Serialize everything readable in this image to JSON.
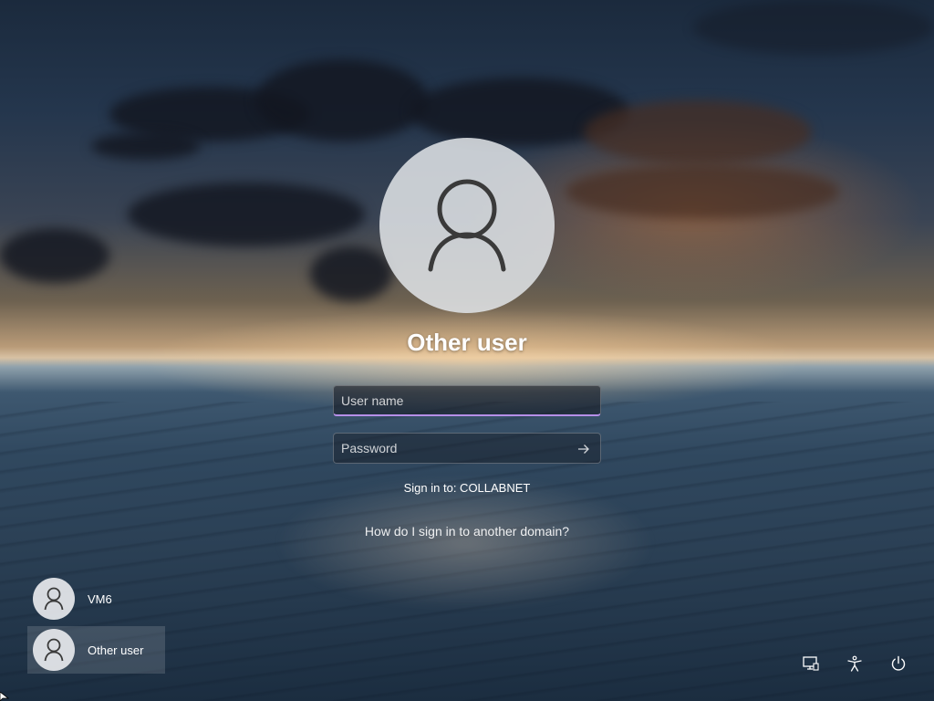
{
  "login": {
    "user_title": "Other user",
    "username_placeholder": "User name",
    "password_placeholder": "Password",
    "sign_in_to": "Sign in to: COLLABNET",
    "domain_link": "How do I sign in to another domain?"
  },
  "user_list": [
    {
      "label": "VM6",
      "selected": false
    },
    {
      "label": "Other user",
      "selected": true
    }
  ],
  "corner_icons": [
    "network-icon",
    "accessibility-icon",
    "power-icon"
  ],
  "colors": {
    "input_focus_accent": "#b68fe8",
    "avatar_bg": "#e1e4e8"
  }
}
